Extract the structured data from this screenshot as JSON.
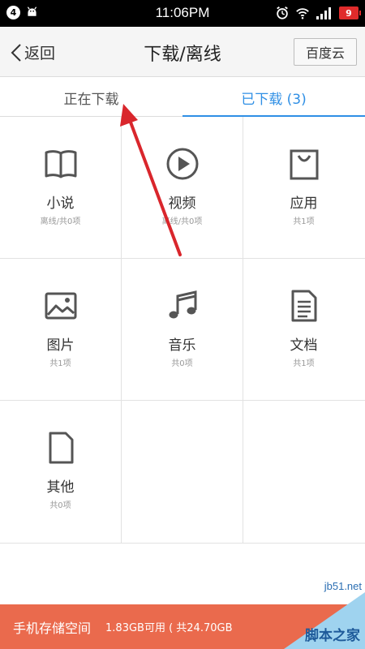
{
  "status_bar": {
    "notification_count": "4",
    "time": "11:06PM",
    "battery": "9"
  },
  "header": {
    "back_label": "返回",
    "title": "下载/离线",
    "cloud_button": "百度云"
  },
  "tabs": [
    {
      "label": "正在下载",
      "active": false
    },
    {
      "label": "已下载  (3)",
      "active": true
    }
  ],
  "categories": [
    {
      "label": "小说",
      "sub": "离线/共0项",
      "icon": "book-icon"
    },
    {
      "label": "视频",
      "sub": "离线/共0项",
      "icon": "play-icon"
    },
    {
      "label": "应用",
      "sub": "共1项",
      "icon": "bag-icon"
    },
    {
      "label": "图片",
      "sub": "共1项",
      "icon": "image-icon"
    },
    {
      "label": "音乐",
      "sub": "共0项",
      "icon": "music-icon"
    },
    {
      "label": "文档",
      "sub": "共1项",
      "icon": "document-icon"
    },
    {
      "label": "其他",
      "sub": "共0项",
      "icon": "file-icon"
    }
  ],
  "storage": {
    "label": "手机存储空间",
    "info": "1.83GB可用 ( 共24.70GB"
  },
  "watermark": {
    "url": "jb51.net",
    "name": "脚本之家"
  },
  "colors": {
    "accent": "#2f8fe5",
    "storage_bar": "#ea6a4d",
    "annotation_arrow": "#d9262c"
  }
}
